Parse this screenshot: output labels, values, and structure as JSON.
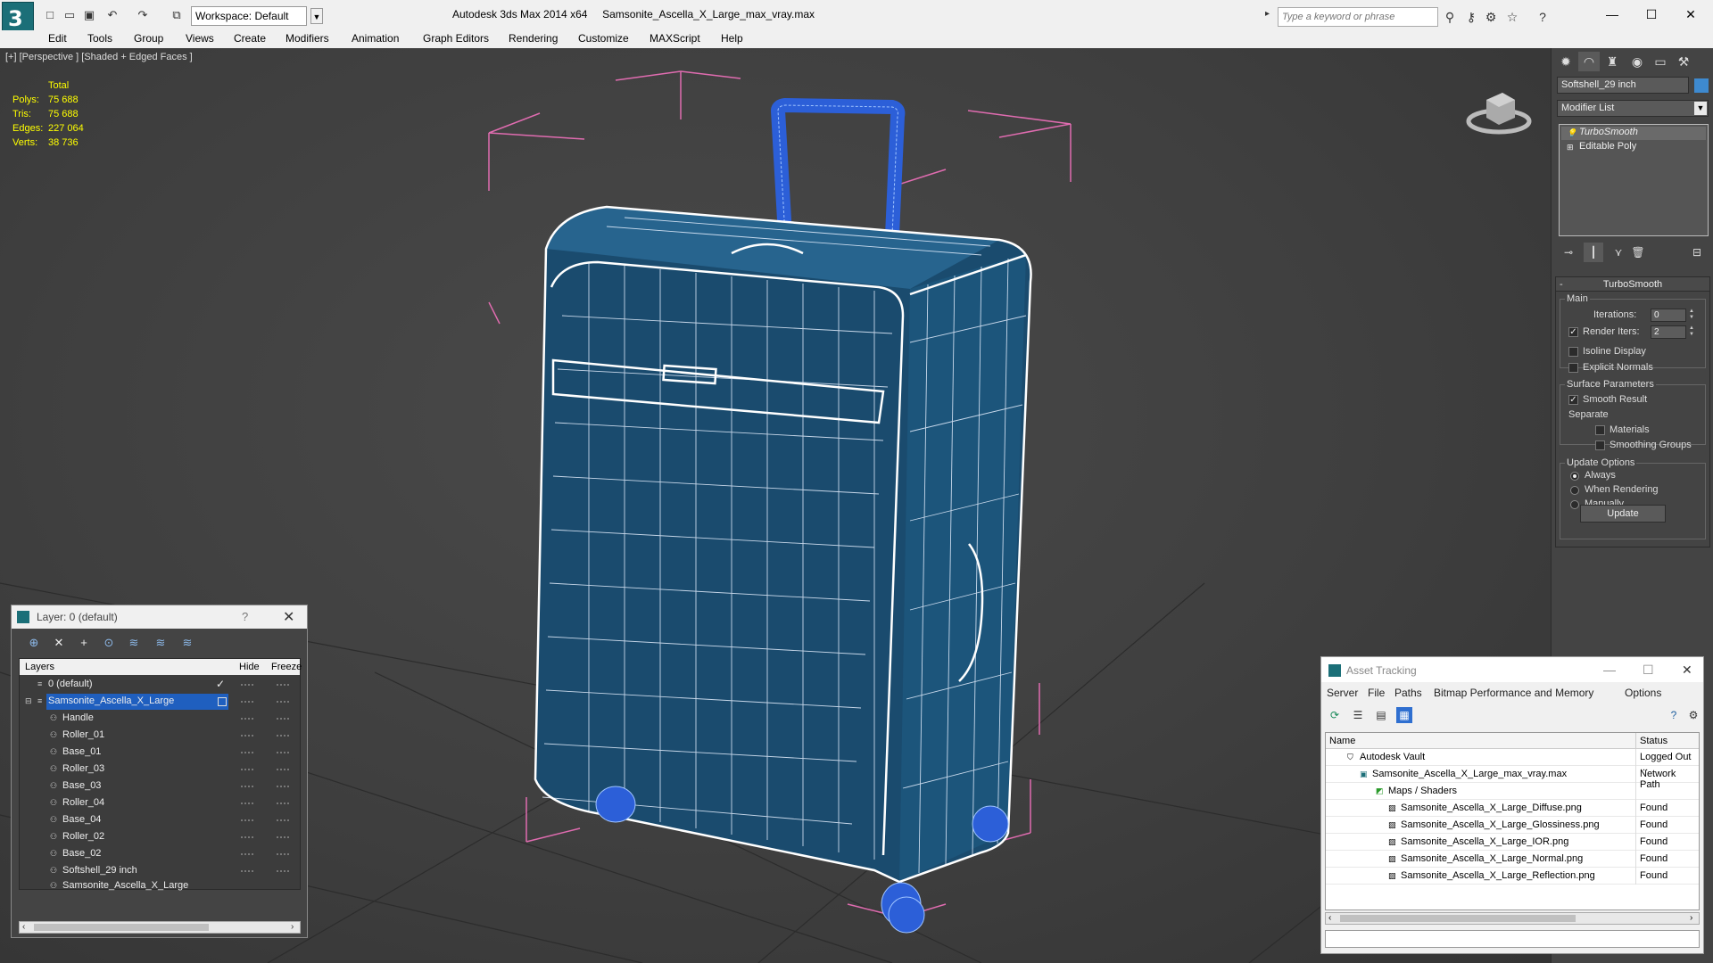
{
  "titlebar": {
    "app_title": "Autodesk 3ds Max  2014 x64",
    "file_name": "Samsonite_Ascella_X_Large_max_vray.max",
    "workspace": "Workspace: Default",
    "search_placeholder": "Type a keyword or phrase"
  },
  "menu": [
    "Edit",
    "Tools",
    "Group",
    "Views",
    "Create",
    "Modifiers",
    "Animation",
    "Graph Editors",
    "Rendering",
    "Customize",
    "MAXScript",
    "Help"
  ],
  "viewport": {
    "label": "[+] [Perspective ] [Shaded + Edged Faces ]",
    "stats_header": "Total",
    "stats": [
      {
        "label": "Polys:",
        "value": "75 688"
      },
      {
        "label": "Tris:",
        "value": "75 688"
      },
      {
        "label": "Edges:",
        "value": "227 064"
      },
      {
        "label": "Verts:",
        "value": "38 736"
      }
    ]
  },
  "command_panel": {
    "object_name": "Softshell_29 inch",
    "object_color": "#3e8ad0",
    "modifier_list": "Modifier List",
    "stack": [
      "TurboSmooth",
      "Editable Poly"
    ],
    "rollout_title": "TurboSmooth",
    "main_group": "Main",
    "iterations_label": "Iterations:",
    "iterations_value": "0",
    "render_iters_label": "Render Iters:",
    "render_iters_value": "2",
    "isoline_label": "Isoline Display",
    "explicit_normals_label": "Explicit Normals",
    "surface_group": "Surface Parameters",
    "smooth_result_label": "Smooth Result",
    "separate_label": "Separate",
    "materials_label": "Materials",
    "smoothing_groups_label": "Smoothing Groups",
    "update_group": "Update Options",
    "always_label": "Always",
    "when_rendering_label": "When Rendering",
    "manually_label": "Manually",
    "update_button": "Update"
  },
  "layer_dialog": {
    "title": "Layer: 0 (default)",
    "help": "?",
    "columns": {
      "layers": "Layers",
      "hide": "Hide",
      "freeze": "Freeze"
    },
    "rows": [
      {
        "name": "0 (default)",
        "level": 1
      },
      {
        "name": "Samsonite_Ascella_X_Large",
        "level": 1
      },
      {
        "name": "Handle",
        "level": 2
      },
      {
        "name": "Roller_01",
        "level": 2
      },
      {
        "name": "Base_01",
        "level": 2
      },
      {
        "name": "Roller_03",
        "level": 2
      },
      {
        "name": "Base_03",
        "level": 2
      },
      {
        "name": "Roller_04",
        "level": 2
      },
      {
        "name": "Base_04",
        "level": 2
      },
      {
        "name": "Roller_02",
        "level": 2
      },
      {
        "name": "Base_02",
        "level": 2
      },
      {
        "name": "Softshell_29 inch",
        "level": 2
      },
      {
        "name": "Samsonite_Ascella_X_Large",
        "level": 2
      }
    ]
  },
  "asset_dialog": {
    "title": "Asset Tracking",
    "menu": [
      "Server",
      "File",
      "Paths",
      "Bitmap Performance and Memory",
      "Options"
    ],
    "columns": {
      "name": "Name",
      "status": "Status"
    },
    "rows": [
      {
        "name": "Autodesk Vault",
        "status": "Logged Out ...",
        "level": 1
      },
      {
        "name": "Samsonite_Ascella_X_Large_max_vray.max",
        "status": "Network Path",
        "level": 2
      },
      {
        "name": "Maps / Shaders",
        "status": "",
        "level": 3
      },
      {
        "name": "Samsonite_Ascella_X_Large_Diffuse.png",
        "status": "Found",
        "level": 4
      },
      {
        "name": "Samsonite_Ascella_X_Large_Glossiness.png",
        "status": "Found",
        "level": 4
      },
      {
        "name": "Samsonite_Ascella_X_Large_IOR.png",
        "status": "Found",
        "level": 4
      },
      {
        "name": "Samsonite_Ascella_X_Large_Normal.png",
        "status": "Found",
        "level": 4
      },
      {
        "name": "Samsonite_Ascella_X_Large_Reflection.png",
        "status": "Found",
        "level": 4
      }
    ]
  }
}
